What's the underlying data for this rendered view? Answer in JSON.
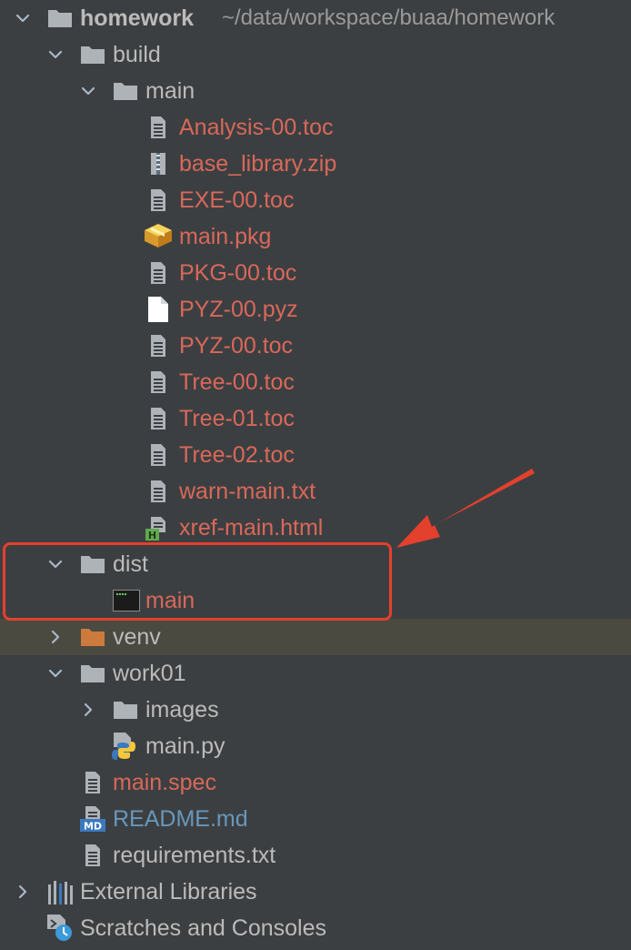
{
  "root": {
    "name": "homework",
    "path": "~/data/workspace/buaa/homework"
  },
  "colors": {
    "background": "#3c3f41",
    "text_default": "#bbbbbb",
    "text_untracked": "#d9685a",
    "text_modified": "#6897bb",
    "folder": "#aeb3b8",
    "folder_excluded": "#cc7a3e",
    "highlight": "#e3402d"
  },
  "tree": [
    {
      "id": "root",
      "level": 0,
      "arrow": "down",
      "icon": "folder",
      "label": "homework",
      "path": "~/data/workspace/buaa/homework",
      "color": "default",
      "bold": true
    },
    {
      "id": "build",
      "level": 1,
      "arrow": "down",
      "icon": "folder",
      "label": "build",
      "color": "default"
    },
    {
      "id": "build-main",
      "level": 2,
      "arrow": "down",
      "icon": "folder",
      "label": "main",
      "color": "default"
    },
    {
      "id": "analysis-toc",
      "level": 3,
      "arrow": "none",
      "icon": "text-file",
      "label": "Analysis-00.toc",
      "color": "untracked"
    },
    {
      "id": "base-library-zip",
      "level": 3,
      "arrow": "none",
      "icon": "archive-file",
      "label": "base_library.zip",
      "color": "untracked"
    },
    {
      "id": "exe-toc",
      "level": 3,
      "arrow": "none",
      "icon": "text-file",
      "label": "EXE-00.toc",
      "color": "untracked"
    },
    {
      "id": "main-pkg",
      "level": 3,
      "arrow": "none",
      "icon": "package-file",
      "label": "main.pkg",
      "color": "untracked"
    },
    {
      "id": "pkg-toc",
      "level": 3,
      "arrow": "none",
      "icon": "text-file",
      "label": "PKG-00.toc",
      "color": "untracked"
    },
    {
      "id": "pyz-pyz",
      "level": 3,
      "arrow": "none",
      "icon": "blank-file",
      "label": "PYZ-00.pyz",
      "color": "untracked"
    },
    {
      "id": "pyz-toc",
      "level": 3,
      "arrow": "none",
      "icon": "text-file",
      "label": "PYZ-00.toc",
      "color": "untracked"
    },
    {
      "id": "tree-00-toc",
      "level": 3,
      "arrow": "none",
      "icon": "text-file",
      "label": "Tree-00.toc",
      "color": "untracked"
    },
    {
      "id": "tree-01-toc",
      "level": 3,
      "arrow": "none",
      "icon": "text-file",
      "label": "Tree-01.toc",
      "color": "untracked"
    },
    {
      "id": "tree-02-toc",
      "level": 3,
      "arrow": "none",
      "icon": "text-file",
      "label": "Tree-02.toc",
      "color": "untracked"
    },
    {
      "id": "warn-main-txt",
      "level": 3,
      "arrow": "none",
      "icon": "text-file",
      "label": "warn-main.txt",
      "color": "untracked"
    },
    {
      "id": "xref-main-html",
      "level": 3,
      "arrow": "none",
      "icon": "html-file",
      "label": "xref-main.html",
      "color": "untracked"
    },
    {
      "id": "dist",
      "level": 1,
      "arrow": "down",
      "icon": "folder",
      "label": "dist",
      "color": "default"
    },
    {
      "id": "dist-main",
      "level": 2,
      "arrow": "none",
      "icon": "executable-file",
      "label": "main",
      "color": "untracked"
    },
    {
      "id": "venv",
      "level": 1,
      "arrow": "right",
      "icon": "folder-excluded",
      "label": "venv",
      "color": "default",
      "selected": true
    },
    {
      "id": "work01",
      "level": 1,
      "arrow": "down",
      "icon": "folder",
      "label": "work01",
      "color": "default"
    },
    {
      "id": "images",
      "level": 2,
      "arrow": "right",
      "icon": "folder",
      "label": "images",
      "color": "default"
    },
    {
      "id": "main-py",
      "level": 2,
      "arrow": "none",
      "icon": "python-file",
      "label": "main.py",
      "color": "default"
    },
    {
      "id": "main-spec",
      "level": 1,
      "arrow": "none",
      "icon": "text-file",
      "label": "main.spec",
      "color": "untracked"
    },
    {
      "id": "readme-md",
      "level": 1,
      "arrow": "none",
      "icon": "markdown-file",
      "label": "README.md",
      "color": "modified"
    },
    {
      "id": "requirements-txt",
      "level": 1,
      "arrow": "none",
      "icon": "text-file",
      "label": "requirements.txt",
      "color": "default"
    },
    {
      "id": "external-libraries",
      "level": 0,
      "arrow": "right",
      "icon": "libraries",
      "label": "External Libraries",
      "color": "default"
    },
    {
      "id": "scratches",
      "level": 0,
      "arrow": "none",
      "icon": "scratches",
      "label": "Scratches and Consoles",
      "color": "default"
    }
  ]
}
